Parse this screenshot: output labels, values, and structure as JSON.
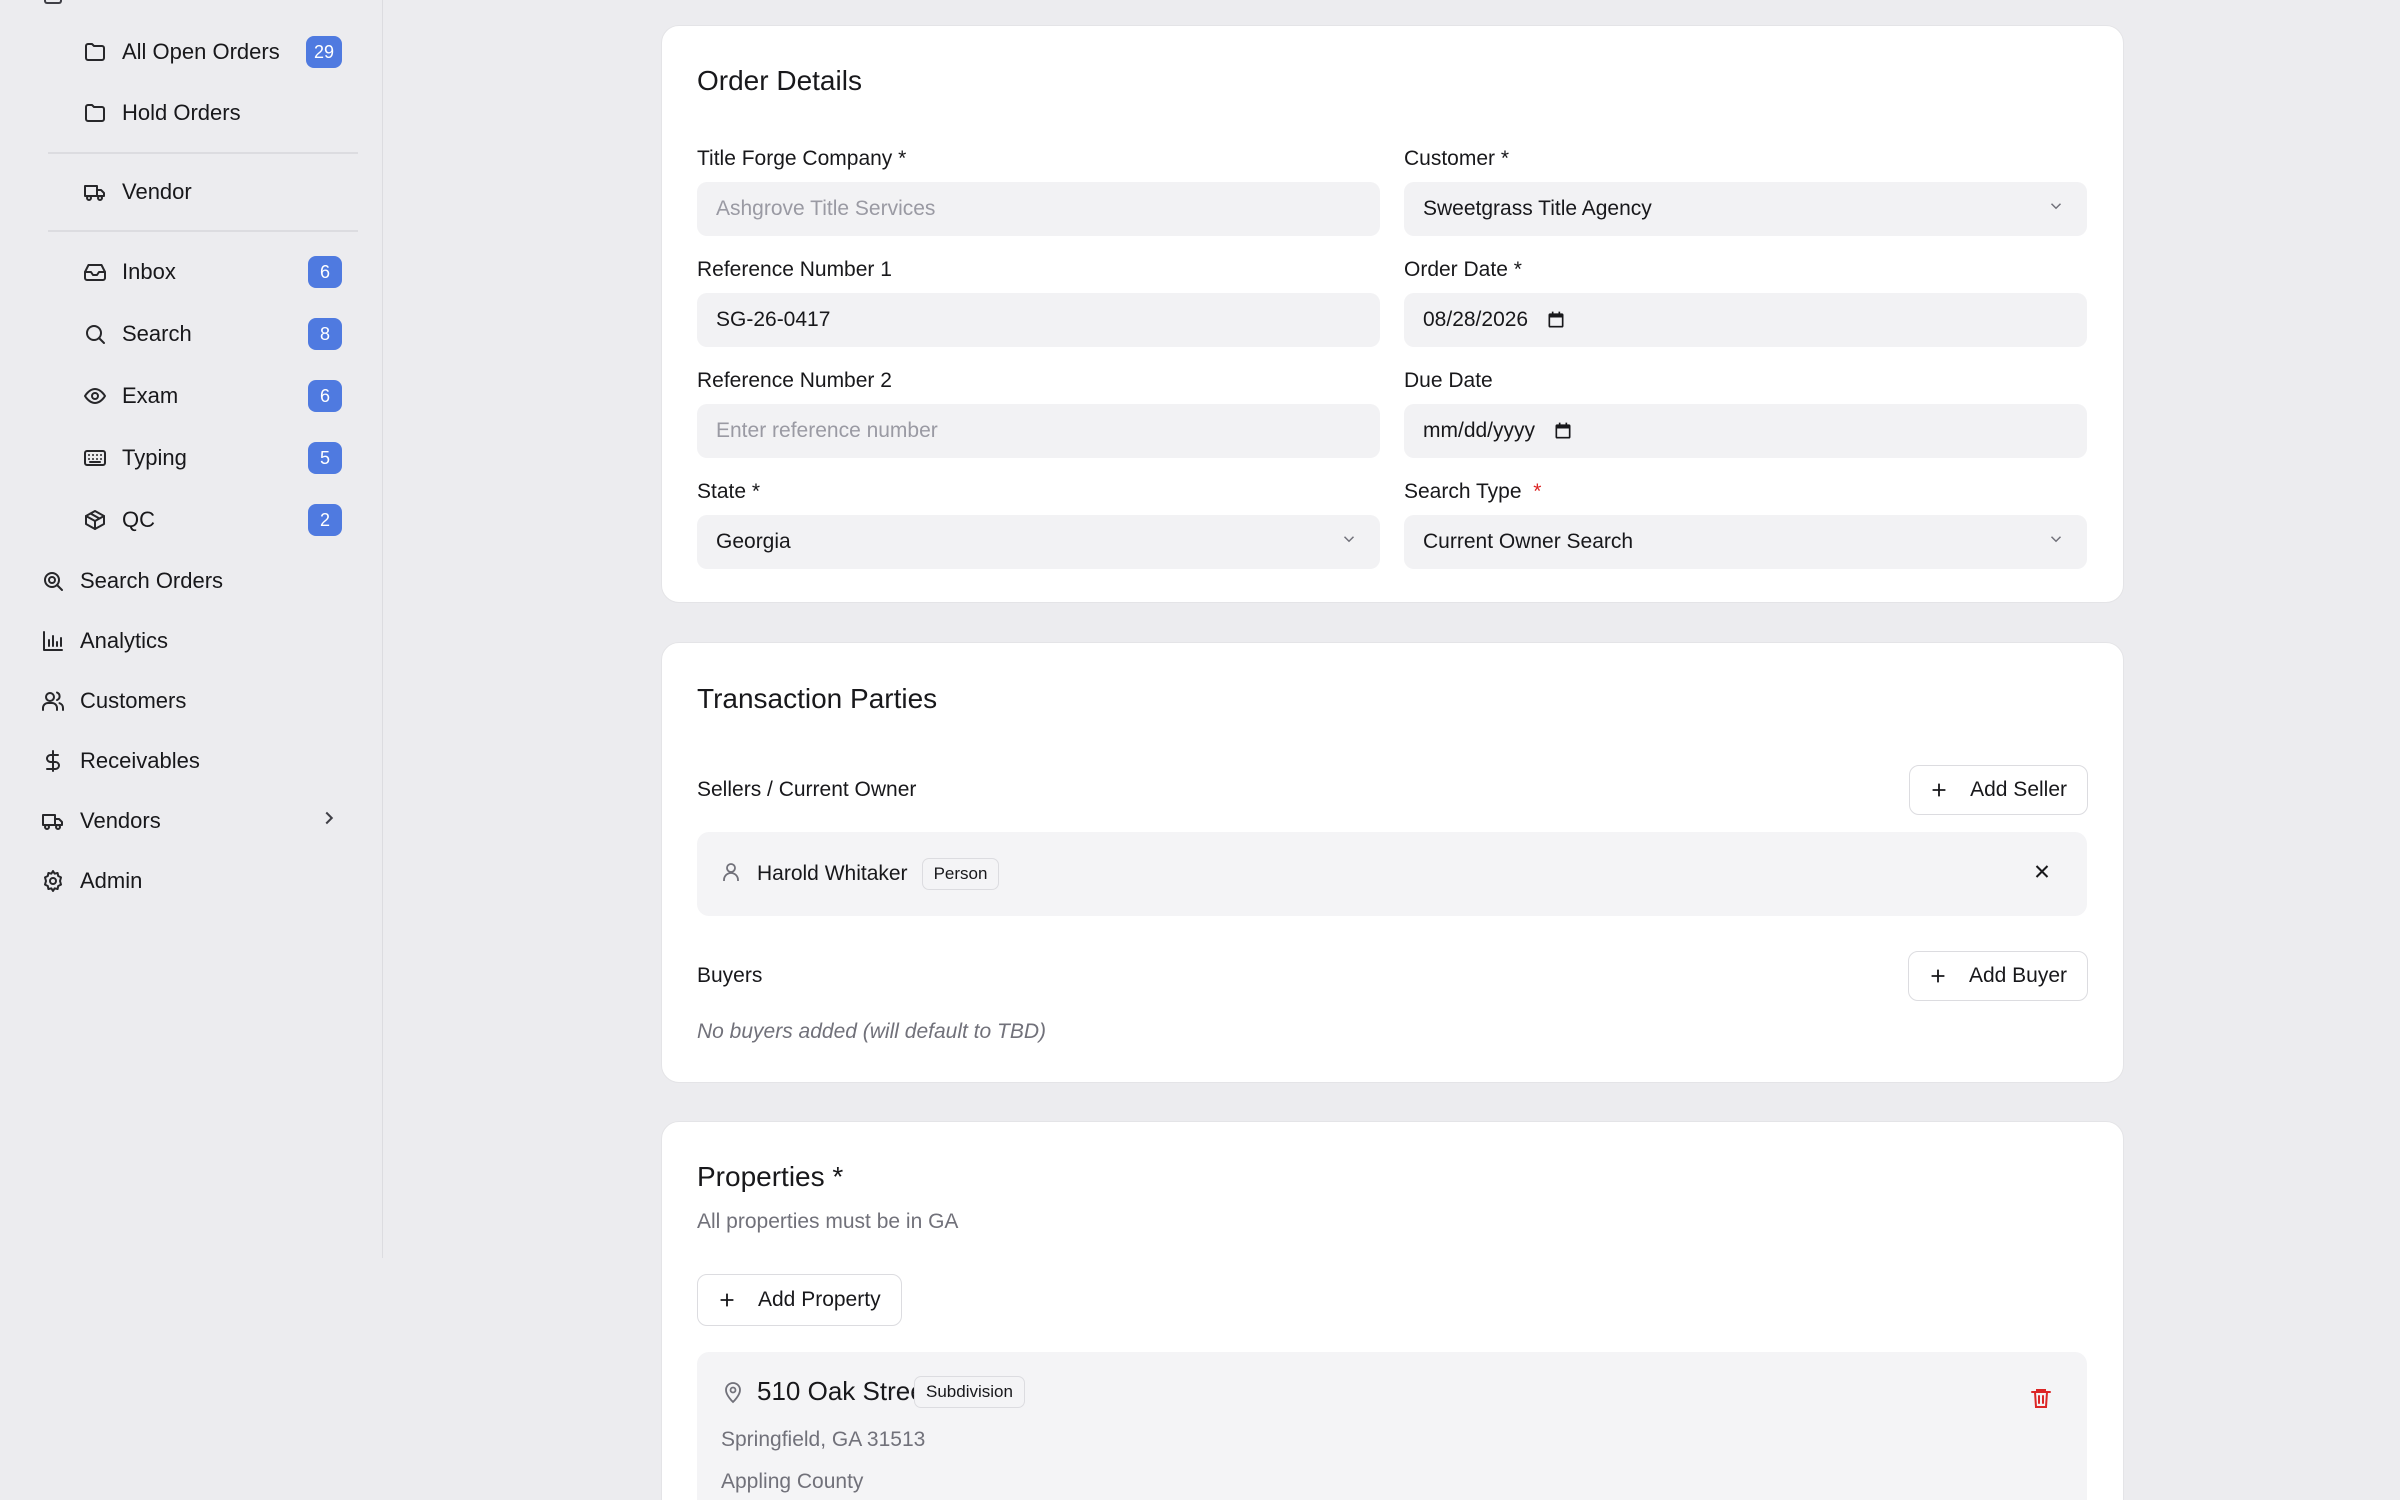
{
  "sidebar": {
    "sub_items": [
      {
        "label": "All Open Orders",
        "badge": "29",
        "icon": "folder-icon"
      },
      {
        "label": "Hold Orders",
        "badge": "",
        "icon": "folder-icon"
      },
      {
        "label": "Vendor",
        "badge": "",
        "icon": "truck-icon"
      },
      {
        "label": "Inbox",
        "badge": "6",
        "icon": "inbox-icon"
      },
      {
        "label": "Search",
        "badge": "8",
        "icon": "search-icon"
      },
      {
        "label": "Exam",
        "badge": "6",
        "icon": "eye-icon"
      },
      {
        "label": "Typing",
        "badge": "5",
        "icon": "keyboard-icon"
      },
      {
        "label": "QC",
        "badge": "2",
        "icon": "package-check-icon"
      }
    ],
    "top_items": [
      {
        "label": "Search Orders",
        "icon": "search-zoom-icon"
      },
      {
        "label": "Analytics",
        "icon": "bar-chart-icon"
      },
      {
        "label": "Customers",
        "icon": "users-icon"
      },
      {
        "label": "Receivables",
        "icon": "dollar-icon"
      },
      {
        "label": "Vendors",
        "icon": "truck-icon"
      },
      {
        "label": "Admin",
        "icon": "gear-icon"
      }
    ]
  },
  "order_details": {
    "title": "Order Details",
    "title_forge_company": {
      "label": "Title Forge Company *",
      "value": "Ashgrove Title Services"
    },
    "customer": {
      "label": "Customer *",
      "value": "Sweetgrass Title Agency"
    },
    "reference_1": {
      "label": "Reference Number 1",
      "value": "SG-26-0417"
    },
    "order_date": {
      "label": "Order Date *",
      "value": "08/28/2026"
    },
    "reference_2": {
      "label": "Reference Number 2",
      "placeholder": "Enter reference number"
    },
    "due_date": {
      "label": "Due Date",
      "placeholder": "mm/dd/yyyy"
    },
    "state": {
      "label": "State *",
      "value": "Georgia"
    },
    "search_type": {
      "label": "Search Type",
      "required_mark": "*",
      "value": "Current Owner Search"
    }
  },
  "transaction_parties": {
    "title": "Transaction Parties",
    "sellers_label": "Sellers / Current Owner",
    "add_seller": "Add Seller",
    "seller": {
      "name": "Harold Whitaker",
      "type": "Person"
    },
    "buyers_label": "Buyers",
    "add_buyer": "Add Buyer",
    "no_buyers": "No buyers added (will default to TBD)"
  },
  "properties": {
    "title": "Properties *",
    "subtitle": "All properties must be in GA",
    "add_property": "Add Property",
    "items": [
      {
        "address": "510 Oak Street",
        "tag": "Subdivision",
        "city_line": "Springfield, GA 31513",
        "county": "Appling County"
      }
    ]
  },
  "colors": {
    "accent": "#4f7ae0",
    "danger": "#dc2626",
    "background": "#ececef"
  }
}
